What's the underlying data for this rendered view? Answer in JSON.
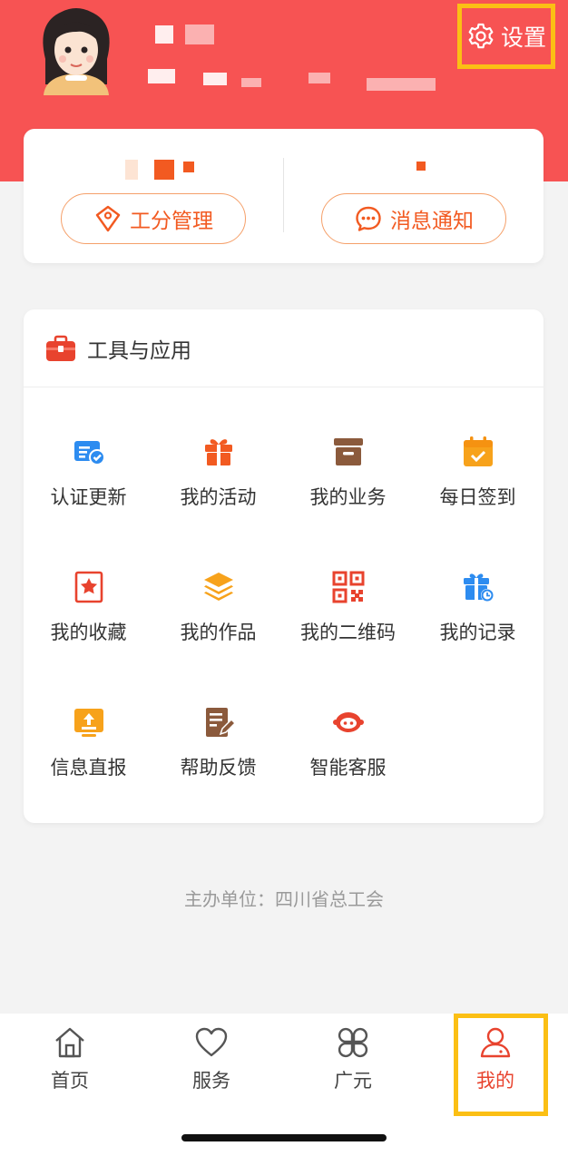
{
  "header": {
    "settings_label": "设置",
    "avatar_icon": "girl-avatar-icon",
    "settings_icon": "gear-icon"
  },
  "stats": {
    "points_button": "工分管理",
    "points_icon": "tag-icon",
    "messages_button": "消息通知",
    "messages_icon": "chat-bubble-icon"
  },
  "tools": {
    "title": "工具与应用",
    "title_icon": "briefcase-icon",
    "items": [
      {
        "label": "认证更新",
        "icon": "certificate-icon",
        "color": "#2d8cf0"
      },
      {
        "label": "我的活动",
        "icon": "gift-icon",
        "color": "#f25a21"
      },
      {
        "label": "我的业务",
        "icon": "archive-box-icon",
        "color": "#8b5a3c"
      },
      {
        "label": "每日签到",
        "icon": "calendar-check-icon",
        "color": "#f7a21b"
      },
      {
        "label": "我的收藏",
        "icon": "star-bookmark-icon",
        "color": "#e8432e"
      },
      {
        "label": "我的作品",
        "icon": "layers-icon",
        "color": "#f7a21b"
      },
      {
        "label": "我的二维码",
        "icon": "qr-code-icon",
        "color": "#e8432e"
      },
      {
        "label": "我的记录",
        "icon": "gift-clock-icon",
        "color": "#2d8cf0"
      },
      {
        "label": "信息直报",
        "icon": "upload-icon",
        "color": "#f7a21b"
      },
      {
        "label": "帮助反馈",
        "icon": "edit-note-icon",
        "color": "#8b5a3c"
      },
      {
        "label": "智能客服",
        "icon": "robot-icon",
        "color": "#e8432e"
      }
    ]
  },
  "footer": {
    "organizer": "主办单位：四川省总工会"
  },
  "tabbar": {
    "tabs": [
      {
        "label": "首页",
        "icon": "home-icon"
      },
      {
        "label": "服务",
        "icon": "heart-icon"
      },
      {
        "label": "广元",
        "icon": "four-petal-icon"
      },
      {
        "label": "我的",
        "icon": "user-icon",
        "active": true
      }
    ]
  },
  "colors": {
    "brand_red": "#f75353",
    "accent_orange": "#f25a21",
    "highlight_yellow": "#fbbf14",
    "active_tab": "#e8432e"
  }
}
